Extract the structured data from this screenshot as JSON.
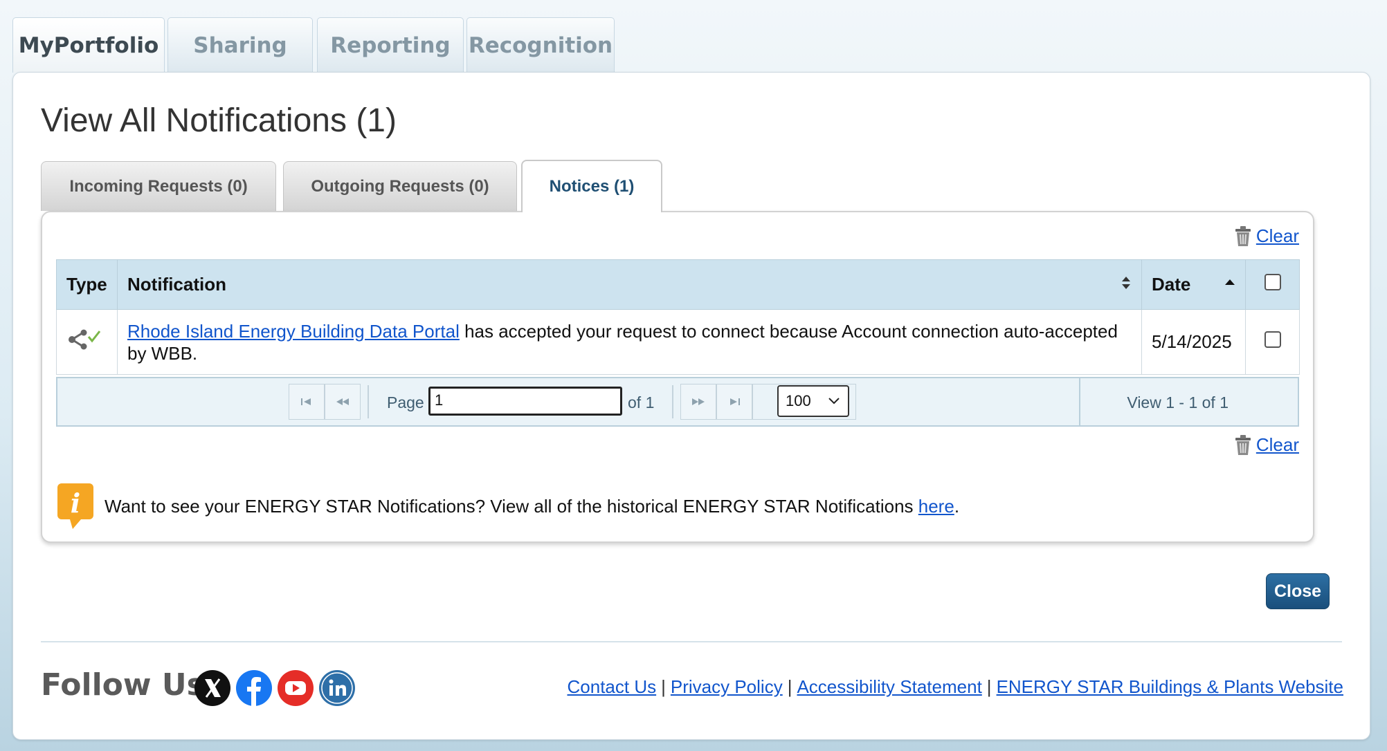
{
  "top_tabs": [
    {
      "label": "MyPortfolio",
      "active": true
    },
    {
      "label": "Sharing",
      "active": false
    },
    {
      "label": "Reporting",
      "active": false
    },
    {
      "label": "Recognition",
      "active": false
    }
  ],
  "page": {
    "title": "View All Notifications (1)"
  },
  "sub_tabs": [
    {
      "label": "Incoming Requests (0)",
      "active": false
    },
    {
      "label": "Outgoing Requests (0)",
      "active": false
    },
    {
      "label": "Notices (1)",
      "active": true
    }
  ],
  "clear_label": "Clear",
  "table": {
    "headers": {
      "type": "Type",
      "notification": "Notification",
      "date": "Date"
    },
    "rows": [
      {
        "type_icon": "share-accepted-icon",
        "link_text": "Rhode Island Energy Building Data Portal",
        "message": " has accepted your request to connect because Account connection auto-accepted by WBB.",
        "date": "5/14/2025"
      }
    ]
  },
  "pager": {
    "page_label": "Page",
    "page_value": "1",
    "of_label": "of 1",
    "page_size": "100",
    "view_text": "View 1 - 1 of 1"
  },
  "info": {
    "text_before": "Want to see your ENERGY STAR Notifications? View all of the historical ENERGY STAR Notifications ",
    "link_text": "here",
    "text_after": ".",
    "accent_color": "#f5a623"
  },
  "close_label": "Close",
  "footer": {
    "follow_label": "Follow Us",
    "social": [
      "x-icon",
      "facebook-icon",
      "youtube-icon",
      "linkedin-icon"
    ],
    "links": [
      "Contact Us",
      "Privacy Policy",
      "Accessibility Statement",
      "ENERGY STAR Buildings & Plants Website"
    ]
  }
}
